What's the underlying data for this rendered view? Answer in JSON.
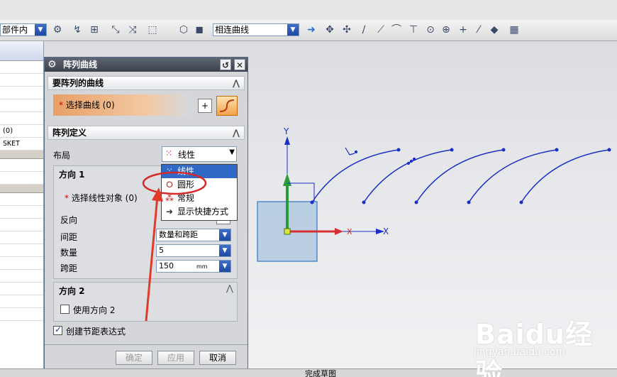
{
  "toolbar": {
    "filter_combo": "部件内",
    "curve_rule_combo": "相连曲线"
  },
  "navigator": {
    "rows": [
      "(0)",
      "SKET"
    ]
  },
  "dialog": {
    "title": "阵列曲线",
    "section_curves": "要阵列的曲线",
    "select_curve_label": "选择曲线",
    "select_curve_count": "(0)",
    "section_pattern": "阵列定义",
    "layout_label": "布局",
    "layout_value": "线性",
    "layout_options": [
      {
        "label": "线性",
        "icon": "linear-layout-icon"
      },
      {
        "label": "圆形",
        "icon": "circular-layout-icon"
      },
      {
        "label": "常规",
        "icon": "general-layout-icon"
      },
      {
        "label": "显示快捷方式",
        "icon": "shortcut-icon"
      }
    ],
    "direction1": {
      "title": "方向 1",
      "select_object_label": "选择线性对象",
      "select_object_count": "(0)",
      "reverse_label": "反向",
      "spacing_label": "间距",
      "spacing_value": "数量和跨距",
      "count_label": "数量",
      "count_value": "5",
      "pitch_label": "跨距",
      "pitch_value": "150",
      "pitch_unit": "mm"
    },
    "direction2": {
      "title": "方向 2",
      "use_label": "使用方向 2"
    },
    "create_expr_label": "创建节距表达式",
    "ok_label": "确定",
    "apply_label": "应用",
    "cancel_label": "取消"
  },
  "viewport": {
    "axis_y_label": "Y",
    "axis_x_label": "X",
    "axis_x_label2": "X"
  },
  "watermark": {
    "brand": "Baidu经验",
    "url": "jingyan.baidu.com"
  },
  "statusbar": {
    "text": "完成草图"
  },
  "colors": {
    "curve": "#1a2fc4",
    "highlight_circle": "#d42a2a",
    "arrow": "#e03a2a",
    "titlebar": "#4a525e",
    "dropdown_selected": "#3169c6"
  }
}
